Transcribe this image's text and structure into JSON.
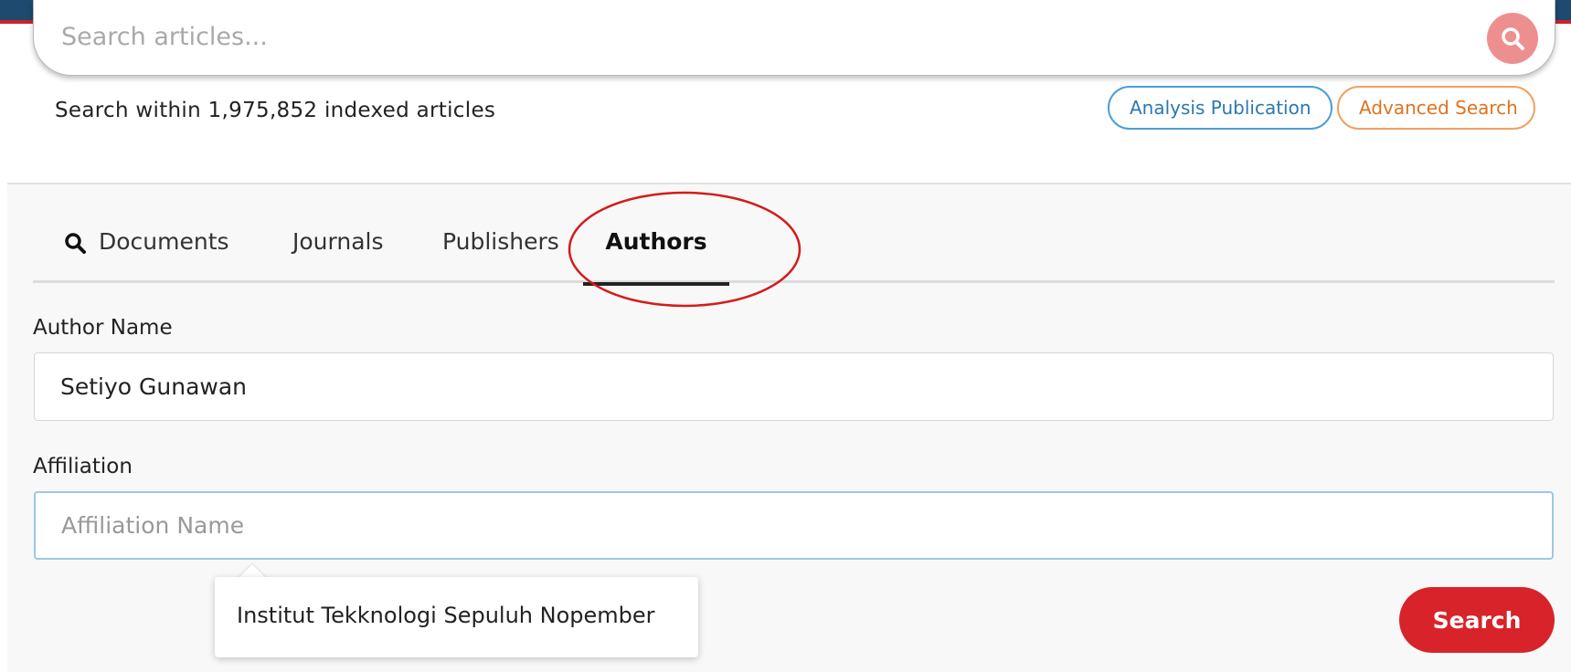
{
  "search": {
    "placeholder": "Search articles...",
    "index_info": "Search within 1,975,852 indexed articles",
    "analysis_button": "Analysis Publication",
    "advanced_button": "Advanced Search"
  },
  "tabs": [
    {
      "label": "Documents",
      "icon": "search-icon"
    },
    {
      "label": "Journals"
    },
    {
      "label": "Publishers"
    },
    {
      "label": "Authors",
      "active": true
    }
  ],
  "form": {
    "author_label": "Author Name",
    "author_value": "Setiyo Gunawan",
    "affiliation_label": "Affiliation",
    "affiliation_placeholder": "Affiliation Name",
    "suggestion": "Institut Tekknologi Sepuluh Nopember",
    "submit_label": "Search"
  },
  "colors": {
    "brand_red": "#d8232a",
    "header_blue": "#1d4a6e",
    "analysis_blue": "#2b78b3",
    "advanced_orange": "#e0721e",
    "annotation_red": "#d41b1b"
  }
}
